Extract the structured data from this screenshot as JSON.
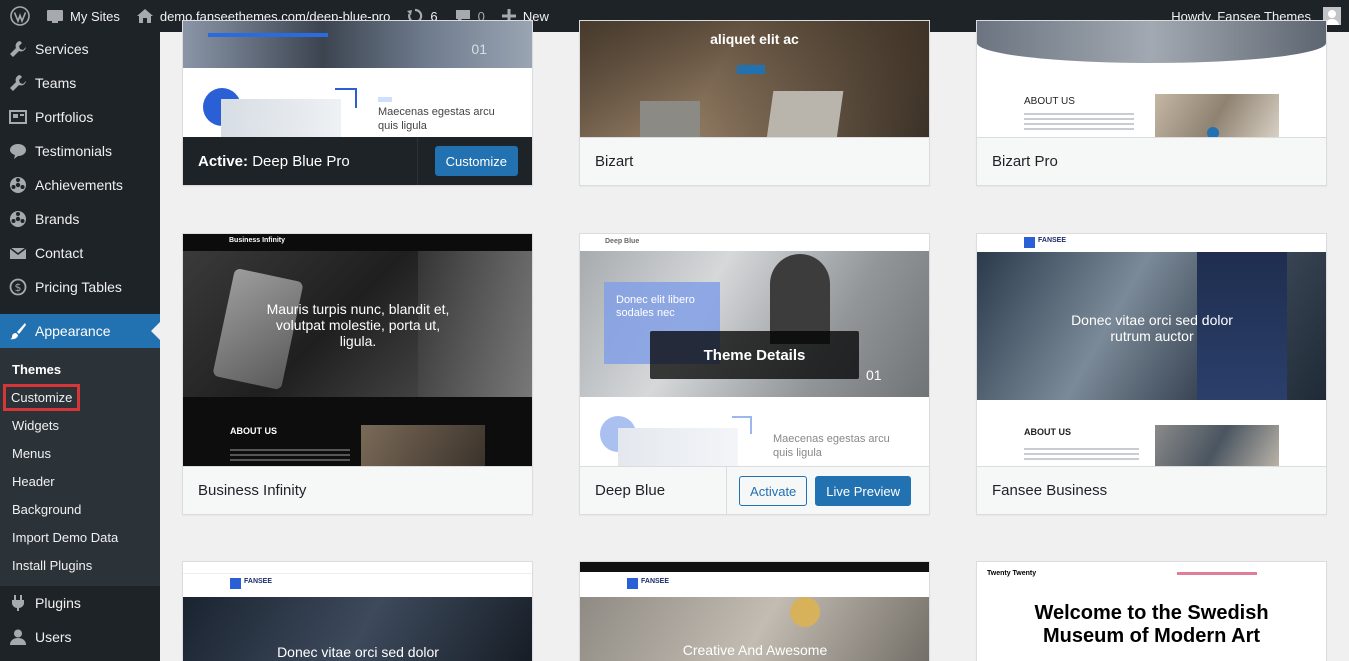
{
  "adminbar": {
    "my_sites": "My Sites",
    "site_url": "demo.fanseethemes.com/deep-blue-pro",
    "updates_count": "6",
    "comments_count": "0",
    "new_label": "New",
    "howdy": "Howdy, Fansee Themes"
  },
  "sidebar": {
    "items": [
      {
        "label": "Services",
        "icon": "wrench-icon"
      },
      {
        "label": "Teams",
        "icon": "wrench-icon"
      },
      {
        "label": "Portfolios",
        "icon": "portfolio-icon"
      },
      {
        "label": "Testimonials",
        "icon": "speech-bubble-icon"
      },
      {
        "label": "Achievements",
        "icon": "star-circle-icon"
      },
      {
        "label": "Brands",
        "icon": "star-circle-icon"
      },
      {
        "label": "Contact",
        "icon": "envelope-icon"
      },
      {
        "label": "Pricing Tables",
        "icon": "dollar-circle-icon"
      }
    ],
    "current": {
      "label": "Appearance",
      "icon": "paintbrush-icon"
    },
    "submenu": [
      "Themes",
      "Customize",
      "Widgets",
      "Menus",
      "Header",
      "Background",
      "Import Demo Data",
      "Install Plugins"
    ],
    "after": [
      {
        "label": "Plugins",
        "icon": "plug-icon"
      },
      {
        "label": "Users",
        "icon": "user-icon"
      }
    ]
  },
  "themes": {
    "active_prefix": "Active:",
    "active_name": "Deep Blue Pro",
    "customize": "Customize",
    "bizart": "Bizart",
    "bizart_pro": "Bizart Pro",
    "business_infinity": "Business Infinity",
    "deep_blue": "Deep Blue",
    "fansee_business": "Fansee Business",
    "activate": "Activate",
    "live_preview": "Live Preview",
    "theme_details": "Theme Details"
  },
  "shots": {
    "t1_num": "01",
    "t1_text": "Maecenas egestas arcu quis ligula",
    "t2_text": "aliquet elit ac",
    "t3_about": "ABOUT US",
    "bi_brand": "Business Infinity",
    "bi_hero": "Mauris turpis nunc, blandit et, volutpat molestie, porta ut, ligula.",
    "bi_about": "ABOUT US",
    "db_brand": "Deep Blue",
    "db_box": "Donec elit libero sodales nec",
    "db_num": "01",
    "db_text": "Maecenas egestas arcu quis ligula",
    "fb_logo": "FANSEE",
    "fb_hero": "Donec vitae orci sed dolor rutrum auctor",
    "fb_about": "ABOUT US",
    "r3a_logo": "FANSEE",
    "r3a_hero": "Donec vitae orci sed dolor",
    "r3b_logo": "FANSEE",
    "r3b_hero": "Creative And Awesome",
    "tt_brand": "Twenty Twenty",
    "tt_title": "Welcome to the Swedish Museum of Modern Art"
  }
}
